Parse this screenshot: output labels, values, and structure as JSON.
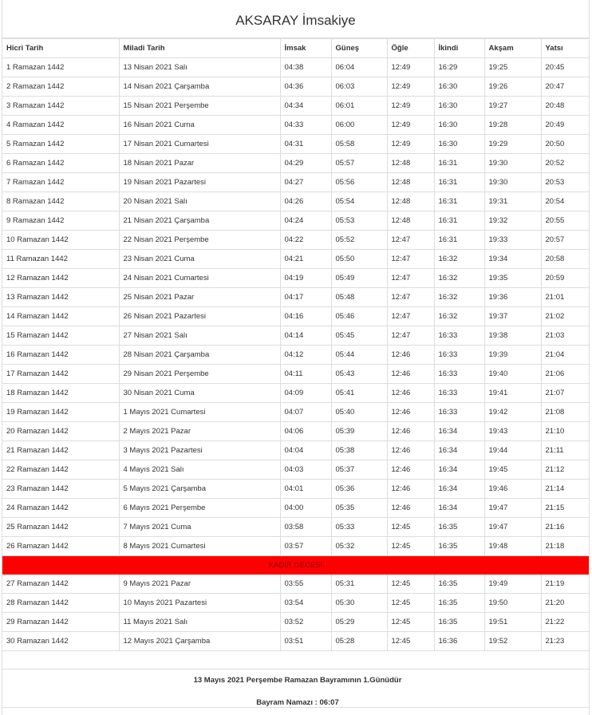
{
  "title": "AKSARAY İmsakiye",
  "columns": [
    "Hicri Tarih",
    "Miladi Tarih",
    "İmsak",
    "Güneş",
    "Öğle",
    "İkindi",
    "Akşam",
    "Yatsı"
  ],
  "rows_before": [
    [
      "1 Ramazan 1442",
      "13 Nisan 2021 Salı",
      "04:38",
      "06:04",
      "12:49",
      "16:29",
      "19:25",
      "20:45"
    ],
    [
      "2 Ramazan 1442",
      "14 Nisan 2021 Çarşamba",
      "04:36",
      "06:03",
      "12:49",
      "16:30",
      "19:26",
      "20:47"
    ],
    [
      "3 Ramazan 1442",
      "15 Nisan 2021 Perşembe",
      "04:34",
      "06:01",
      "12:49",
      "16:30",
      "19:27",
      "20:48"
    ],
    [
      "4 Ramazan 1442",
      "16 Nisan 2021 Cuma",
      "04:33",
      "06:00",
      "12:49",
      "16:30",
      "19:28",
      "20:49"
    ],
    [
      "5 Ramazan 1442",
      "17 Nisan 2021 Cumartesi",
      "04:31",
      "05:58",
      "12:49",
      "16:30",
      "19:29",
      "20:50"
    ],
    [
      "6 Ramazan 1442",
      "18 Nisan 2021 Pazar",
      "04:29",
      "05:57",
      "12:48",
      "16:31",
      "19:30",
      "20:52"
    ],
    [
      "7 Ramazan 1442",
      "19 Nisan 2021 Pazartesi",
      "04:27",
      "05:56",
      "12:48",
      "16:31",
      "19:30",
      "20:53"
    ],
    [
      "8 Ramazan 1442",
      "20 Nisan 2021 Salı",
      "04:26",
      "05:54",
      "12:48",
      "16:31",
      "19:31",
      "20:54"
    ],
    [
      "9 Ramazan 1442",
      "21 Nisan 2021 Çarşamba",
      "04:24",
      "05:53",
      "12:48",
      "16:31",
      "19:32",
      "20:55"
    ],
    [
      "10 Ramazan 1442",
      "22 Nisan 2021 Perşembe",
      "04:22",
      "05:52",
      "12:47",
      "16:31",
      "19:33",
      "20:57"
    ],
    [
      "11 Ramazan 1442",
      "23 Nisan 2021 Cuma",
      "04:21",
      "05:50",
      "12:47",
      "16:32",
      "19:34",
      "20:58"
    ],
    [
      "12 Ramazan 1442",
      "24 Nisan 2021 Cumartesi",
      "04:19",
      "05:49",
      "12:47",
      "16:32",
      "19:35",
      "20:59"
    ],
    [
      "13 Ramazan 1442",
      "25 Nisan 2021 Pazar",
      "04:17",
      "05:48",
      "12:47",
      "16:32",
      "19:36",
      "21:01"
    ],
    [
      "14 Ramazan 1442",
      "26 Nisan 2021 Pazartesi",
      "04:16",
      "05:46",
      "12:47",
      "16:32",
      "19:37",
      "21:02"
    ],
    [
      "15 Ramazan 1442",
      "27 Nisan 2021 Salı",
      "04:14",
      "05:45",
      "12:47",
      "16:33",
      "19:38",
      "21:03"
    ],
    [
      "16 Ramazan 1442",
      "28 Nisan 2021 Çarşamba",
      "04:12",
      "05:44",
      "12:46",
      "16:33",
      "19:39",
      "21:04"
    ],
    [
      "17 Ramazan 1442",
      "29 Nisan 2021 Perşembe",
      "04:11",
      "05:43",
      "12:46",
      "16:33",
      "19:40",
      "21:06"
    ],
    [
      "18 Ramazan 1442",
      "30 Nisan 2021 Cuma",
      "04:09",
      "05:41",
      "12:46",
      "16:33",
      "19:41",
      "21:07"
    ],
    [
      "19 Ramazan 1442",
      "1 Mayıs 2021 Cumartesi",
      "04:07",
      "05:40",
      "12:46",
      "16:33",
      "19:42",
      "21:08"
    ],
    [
      "20 Ramazan 1442",
      "2 Mayıs 2021 Pazar",
      "04:06",
      "05:39",
      "12:46",
      "16:34",
      "19:43",
      "21:10"
    ],
    [
      "21 Ramazan 1442",
      "3 Mayıs 2021 Pazartesi",
      "04:04",
      "05:38",
      "12:46",
      "16:34",
      "19:44",
      "21:11"
    ],
    [
      "22 Ramazan 1442",
      "4 Mayıs 2021 Salı",
      "04:03",
      "05:37",
      "12:46",
      "16:34",
      "19:45",
      "21:12"
    ],
    [
      "23 Ramazan 1442",
      "5 Mayıs 2021 Çarşamba",
      "04:01",
      "05:36",
      "12:46",
      "16:34",
      "19:46",
      "21:14"
    ],
    [
      "24 Ramazan 1442",
      "6 Mayıs 2021 Perşembe",
      "04:00",
      "05:35",
      "12:46",
      "16:34",
      "19:47",
      "21:15"
    ],
    [
      "25 Ramazan 1442",
      "7 Mayıs 2021 Cuma",
      "03:58",
      "05:33",
      "12:45",
      "16:35",
      "19:47",
      "21:16"
    ],
    [
      "26 Ramazan 1442",
      "8 Mayıs 2021 Cumartesi",
      "03:57",
      "05:32",
      "12:45",
      "16:35",
      "19:48",
      "21:18"
    ]
  ],
  "kadir_label": "KADİR GECESİ",
  "kadir_color": "#ff0000",
  "rows_after": [
    [
      "27 Ramazan 1442",
      "9 Mayıs 2021 Pazar",
      "03:55",
      "05:31",
      "12:45",
      "16:35",
      "19:49",
      "21:19"
    ],
    [
      "28 Ramazan 1442",
      "10 Mayıs 2021 Pazartesi",
      "03:54",
      "05:30",
      "12:45",
      "16:35",
      "19:50",
      "21:20"
    ],
    [
      "29 Ramazan 1442",
      "11 Mayıs 2021 Salı",
      "03:52",
      "05:29",
      "12:45",
      "16:35",
      "19:51",
      "21:22"
    ],
    [
      "30 Ramazan 1442",
      "12 Mayıs 2021 Çarşamba",
      "03:51",
      "05:28",
      "12:45",
      "16:36",
      "19:52",
      "21:23"
    ]
  ],
  "footer": {
    "bayram_text": "13 Mayıs 2021 Perşembe Ramazan Bayramının 1.Günüdür",
    "namaz_text": "Bayram Namazı : 06:07"
  }
}
